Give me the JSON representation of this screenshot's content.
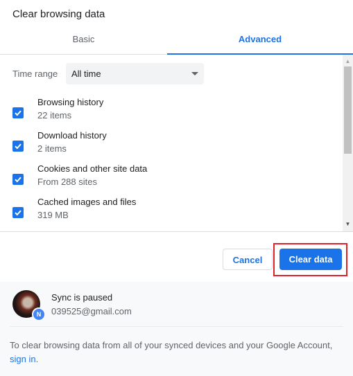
{
  "dialog": {
    "title": "Clear browsing data"
  },
  "tabs": [
    {
      "label": "Basic",
      "active": false
    },
    {
      "label": "Advanced",
      "active": true
    }
  ],
  "time_range": {
    "label": "Time range",
    "selected": "All time"
  },
  "items": [
    {
      "label": "Browsing history",
      "detail": "22 items",
      "checked": true
    },
    {
      "label": "Download history",
      "detail": "2 items",
      "checked": true
    },
    {
      "label": "Cookies and other site data",
      "detail": "From 288 sites",
      "checked": true
    },
    {
      "label": "Cached images and files",
      "detail": "319 MB",
      "checked": true
    }
  ],
  "buttons": {
    "cancel": "Cancel",
    "clear": "Clear data"
  },
  "sync": {
    "status": "Sync is paused",
    "email": "039525@gmail.com",
    "note": "To clear browsing data from all of your synced devices and your Google Account,",
    "link": "sign in",
    "link_suffix": "."
  },
  "colors": {
    "accent": "#1a73e8",
    "highlight": "#e0202b"
  }
}
